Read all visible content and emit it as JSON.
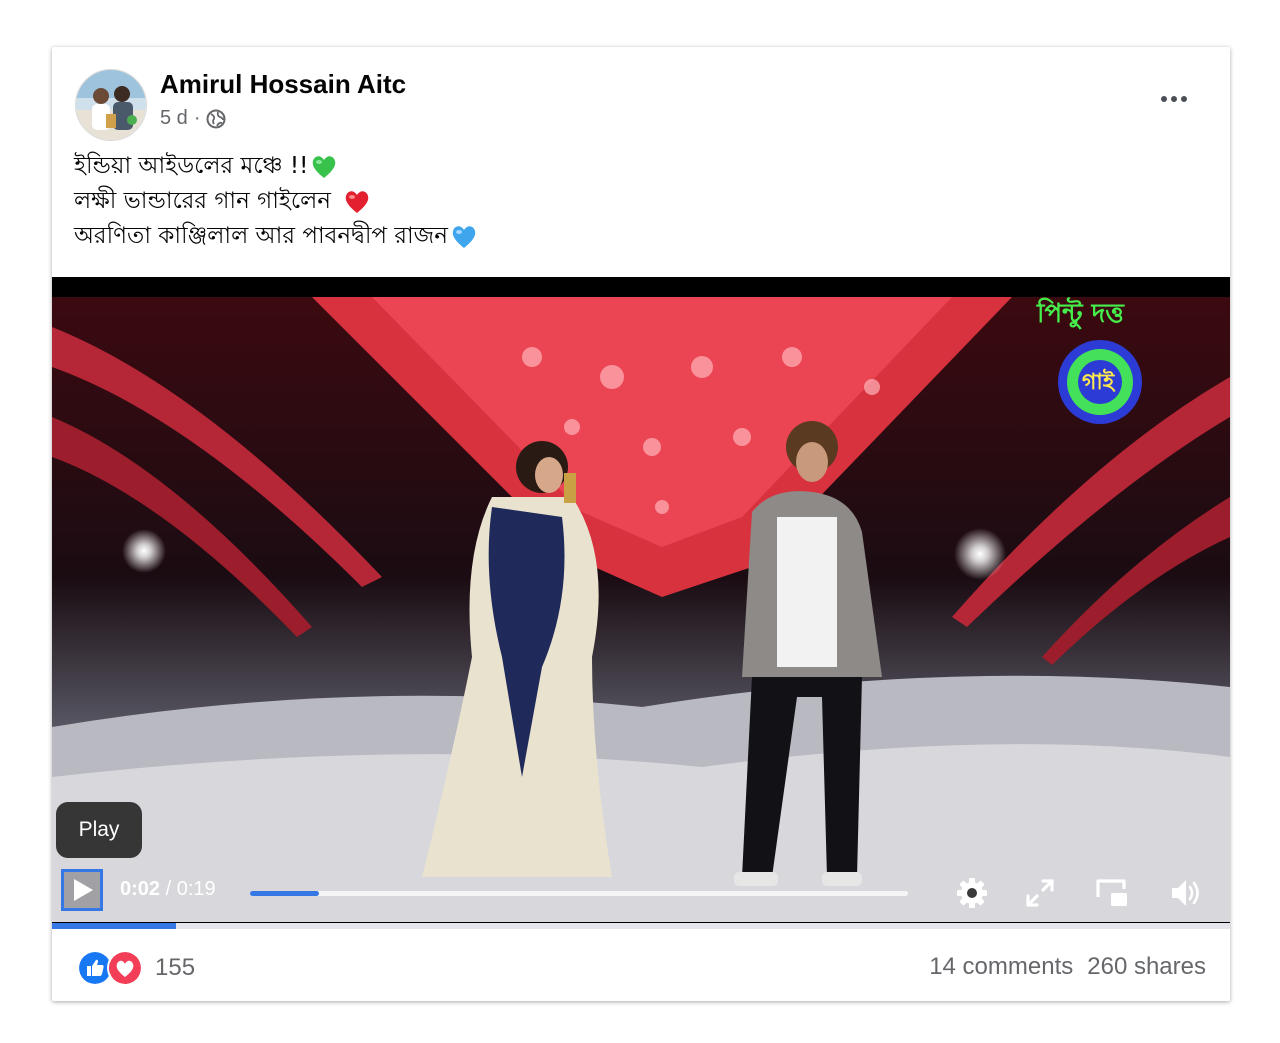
{
  "post": {
    "author": "Amirul Hossain Aitc",
    "time": "5 d",
    "separator": "·",
    "caption": [
      "ইন্ডিয়া আইডলের মঞ্চে !!",
      "লক্ষী ভান্ডারের গান গাইলেন",
      "অরণিতা কাঞ্জিলাল আর পাবনদ্বীপ রাজন"
    ]
  },
  "video": {
    "watermark_text": "পিন্টু দত্ত",
    "logo_text": "গাই",
    "tooltip": "Play",
    "current_time": "0:02",
    "time_separator": " / ",
    "duration": "0:19",
    "played_fraction": 0.105
  },
  "engagement": {
    "reaction_count": "155",
    "comments": "14 comments",
    "shares": "260 shares"
  },
  "icons": {
    "like": "like-reaction-icon",
    "love": "love-reaction-icon",
    "audience": "globe-icon",
    "more": "more-options-icon"
  },
  "colors": {
    "accent": "#3578e5",
    "text_primary": "#050505",
    "text_secondary": "#65676b",
    "love": "#f33e58"
  }
}
